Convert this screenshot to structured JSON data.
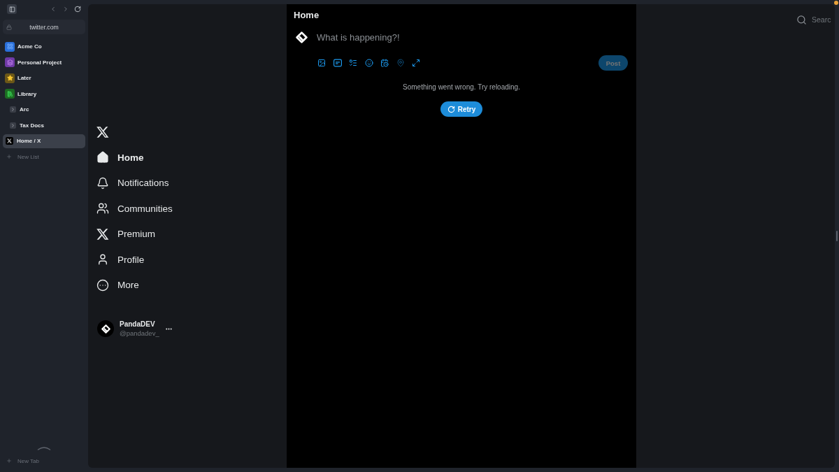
{
  "sidebar": {
    "url": "twitter.com",
    "items": [
      {
        "kind": "pinned",
        "label": "Acme Co",
        "color": "#2a6fd9",
        "selected": false
      },
      {
        "kind": "pinned",
        "label": "Personal Project",
        "color": "#6f3aa6",
        "selected": false
      },
      {
        "kind": "pinned",
        "label": "Later",
        "color": "#6b5718",
        "selected": false
      },
      {
        "kind": "pinned",
        "label": "Library",
        "color": "#1d6b22",
        "selected": false,
        "children": [
          {
            "kind": "folder",
            "label": "Arc",
            "expanded": false,
            "selected": false
          },
          {
            "kind": "folder",
            "label": "Tax Docs",
            "expanded": false,
            "selected": false
          }
        ]
      },
      {
        "kind": "tab",
        "label": "Home / X",
        "selected": true
      }
    ],
    "new_list": "New List",
    "new_tab": "New Tab"
  },
  "nav": {
    "items": [
      {
        "label": "Home",
        "selected": true
      },
      {
        "label": "Notifications",
        "selected": false
      },
      {
        "label": "Communities",
        "selected": false
      },
      {
        "label": "Premium",
        "selected": false
      },
      {
        "label": "Profile",
        "selected": false
      },
      {
        "label": "More",
        "selected": false
      }
    ]
  },
  "account": {
    "name": "PandaDEV",
    "handle": "@pandadev_"
  },
  "timeline": {
    "title": "Home",
    "compose": {
      "placeholder": "What is happening?!",
      "tools": [
        {
          "disabled": false
        },
        {
          "disabled": false
        },
        {
          "disabled": false
        },
        {
          "disabled": false
        },
        {
          "disabled": false
        },
        {
          "disabled": true
        },
        {
          "disabled": false
        }
      ],
      "post_button": {
        "label": "Post",
        "disabled": true
      }
    },
    "error": "Something went wrong. Try reloading.",
    "retry": "Retry"
  },
  "search": {
    "placeholder": "Searc"
  }
}
